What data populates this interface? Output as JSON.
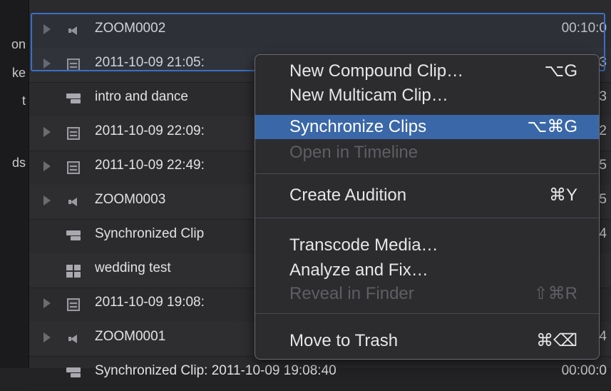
{
  "sidebar": {
    "fragments": [
      "on",
      "ke",
      "t",
      "ds"
    ]
  },
  "rows": [
    {
      "name": "ZOOM0002",
      "icon": "audio-clip-icon",
      "duration": "00:10:0",
      "disclosure": true
    },
    {
      "name": "2011-10-09 21:05:",
      "icon": "video-clip-icon",
      "duration": "3",
      "disclosure": true
    },
    {
      "name": "intro and dance",
      "icon": "compound-clip-icon",
      "duration": "3",
      "disclosure": false
    },
    {
      "name": "2011-10-09 22:09:",
      "icon": "video-clip-icon",
      "duration": "2",
      "disclosure": true
    },
    {
      "name": "2011-10-09 22:49:",
      "icon": "video-clip-icon",
      "duration": "5",
      "disclosure": true
    },
    {
      "name": "ZOOM0003",
      "icon": "audio-clip-icon",
      "duration": "5",
      "disclosure": true
    },
    {
      "name": "Synchronized Clip",
      "icon": "compound-clip-icon",
      "duration": "4",
      "disclosure": false
    },
    {
      "name": "wedding test",
      "icon": "multicam-clip-icon",
      "duration": "",
      "disclosure": false
    },
    {
      "name": "2011-10-09 19:08:",
      "icon": "video-clip-icon",
      "duration": "",
      "disclosure": true
    },
    {
      "name": "ZOOM0001",
      "icon": "audio-clip-icon",
      "duration": "4",
      "disclosure": true
    },
    {
      "name": "Synchronized Clip: 2011-10-09 19:08:40",
      "icon": "compound-clip-icon",
      "duration": "00:00:0",
      "disclosure": false
    }
  ],
  "context_menu": {
    "items": [
      {
        "label": "New Compound Clip…",
        "shortcut": "⌥G",
        "state": "normal"
      },
      {
        "label": "New Multicam Clip…",
        "shortcut": "",
        "state": "normal"
      },
      {
        "label": "Synchronize Clips",
        "shortcut": "⌥⌘G",
        "state": "highlighted"
      },
      {
        "label": "Open in Timeline",
        "shortcut": "",
        "state": "disabled"
      },
      {
        "label": "Create Audition",
        "shortcut": "⌘Y",
        "state": "normal"
      },
      {
        "label": "Transcode Media…",
        "shortcut": "",
        "state": "normal"
      },
      {
        "label": "Analyze and Fix…",
        "shortcut": "",
        "state": "normal"
      },
      {
        "label": "Reveal in Finder",
        "shortcut": "⇧⌘R",
        "state": "disabled"
      },
      {
        "label": "Move to Trash",
        "shortcut": "⌘⌫",
        "state": "normal"
      }
    ]
  },
  "colors": {
    "selection": "#3a6fc4",
    "menu_highlight": "#3a67a8",
    "disabled_text": "#5e5e63"
  }
}
